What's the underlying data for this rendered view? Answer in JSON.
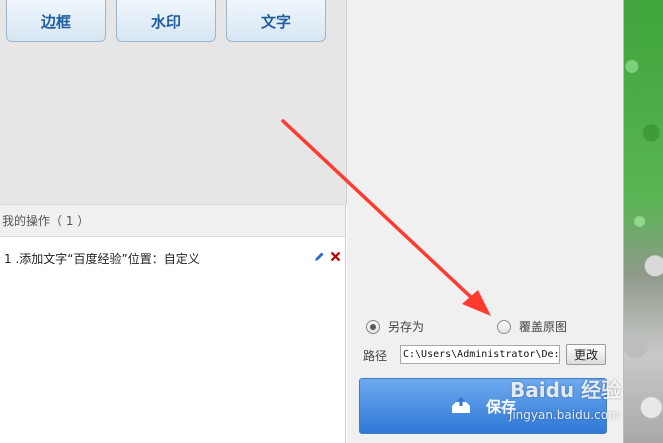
{
  "toolbar": {
    "buttons": [
      {
        "label": "边框"
      },
      {
        "label": "水印"
      },
      {
        "label": "文字"
      }
    ]
  },
  "operations": {
    "header": "我的操作（ 1 ）",
    "items": [
      {
        "text": "1 .添加文字“百度经验”位置：自定义"
      }
    ]
  },
  "save_panel": {
    "option_save_as": "另存为",
    "option_overwrite": "覆盖原图",
    "selected": "save_as",
    "path_label": "路径",
    "path_value": "C:\\Users\\Administrator\\De:",
    "change_label": "更改",
    "save_label": "保存"
  },
  "watermark": {
    "brand": "Baidu 经验",
    "url": "jingyan.baidu.com"
  },
  "colors": {
    "arrow": "#ff3b30",
    "save_button": "#3d86dc",
    "tool_button_text": "#1f5f9f"
  }
}
